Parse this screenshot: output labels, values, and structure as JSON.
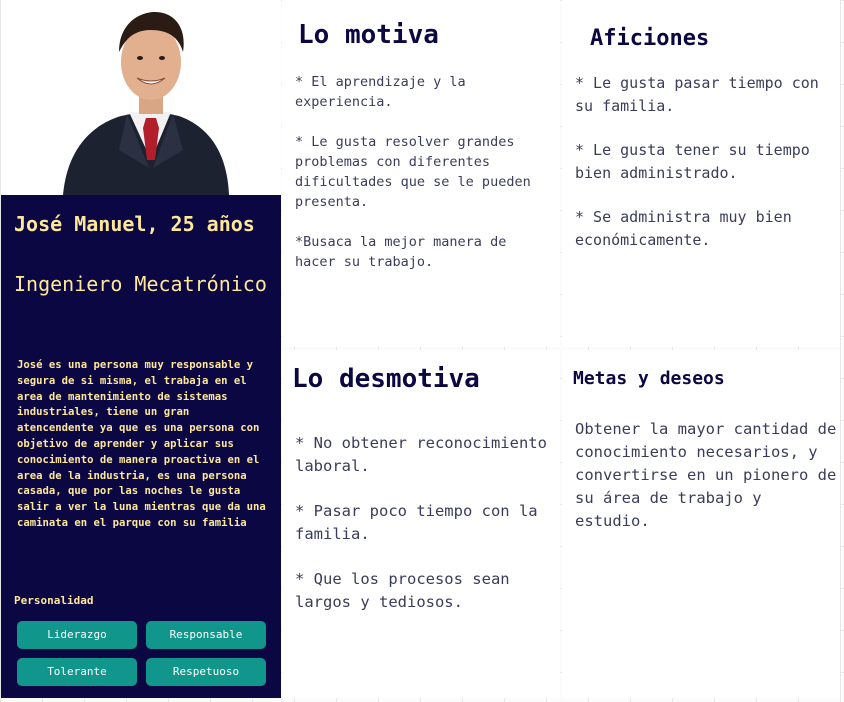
{
  "profile": {
    "name": "José Manuel, 25 años",
    "role": "Ingeniero Mecatrónico",
    "bio": "José es una persona muy responsable y segura de si misma, el trabaja en el area de mantenimiento de sistemas industriales, tiene un gran atencendente ya que es una persona con objetivo de aprender y aplicar sus conocimiento de manera proactiva en el area de la industria, es una persona casada, que por las noches le gusta salir a ver la luna mientras que da una caminata en el parque con su familia",
    "personality_label": "Personalidad",
    "traits": [
      "Liderazgo",
      "Responsable",
      "Tolerante",
      "Respetuoso"
    ]
  },
  "motiva": {
    "title": "Lo motiva",
    "items": [
      "* El aprendizaje y la experiencia.",
      "* Le gusta resolver grandes problemas con diferentes dificultades que se le pueden presenta.",
      "*Busaca la mejor manera de hacer su trabajo."
    ]
  },
  "aficiones": {
    "title": "Aficiones",
    "items": [
      "* Le gusta pasar tiempo con su familia.",
      "* Le gusta tener su tiempo bien administrado.",
      "* Se administra muy bien económicamente."
    ]
  },
  "desmotiva": {
    "title": "Lo desmotiva",
    "items": [
      "* No obtener reconocimiento laboral.",
      "* Pasar poco tiempo con la familia.",
      "* Que los procesos sean largos y tediosos."
    ]
  },
  "metas": {
    "title": "Metas y deseos",
    "text": "Obtener la mayor cantidad de conocimiento necesarios, y convertirse en un pionero de su área de trabajo y estudio."
  }
}
